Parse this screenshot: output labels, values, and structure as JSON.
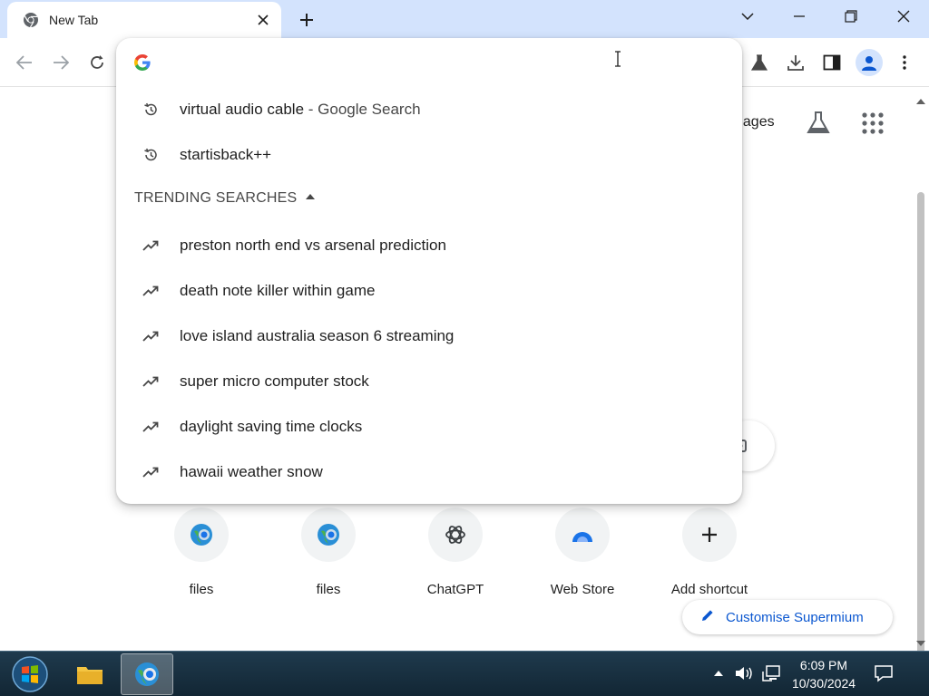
{
  "browser": {
    "tab": {
      "title": "New Tab",
      "favicon": "chrome-icon"
    },
    "toolbar": {
      "back": "back-arrow-icon",
      "forward": "forward-arrow-icon",
      "reload": "reload-icon",
      "labs": "labs-flask-icon",
      "download": "download-icon",
      "side_panel": "side-panel-icon",
      "profile": "profile-icon",
      "menu": "more-vert-icon"
    }
  },
  "omnibox": {
    "value": "",
    "recent": [
      {
        "text": "virtual audio cable",
        "suffix": " - Google Search",
        "icon": "history-icon"
      },
      {
        "text": "startisback++",
        "suffix": "",
        "icon": "history-icon"
      }
    ],
    "trending_header": "TRENDING SEARCHES",
    "trending": [
      {
        "text": "preston north end vs arsenal prediction"
      },
      {
        "text": "death note killer within game"
      },
      {
        "text": "love island australia season 6 streaming"
      },
      {
        "text": "super micro computer stock"
      },
      {
        "text": "daylight saving time clocks"
      },
      {
        "text": "hawaii weather snow"
      }
    ]
  },
  "page": {
    "images_link": "nages",
    "shortcuts": [
      {
        "label": "files",
        "icon": "globe-icon"
      },
      {
        "label": "files",
        "icon": "globe-icon"
      },
      {
        "label": "ChatGPT",
        "icon": "chatgpt-icon"
      },
      {
        "label": "Web Store",
        "icon": "web-store-icon"
      },
      {
        "label": "Add shortcut",
        "icon": "plus-icon"
      }
    ],
    "customise_label": "Customise Supermium"
  },
  "taskbar": {
    "time": "6:09 PM",
    "date": "10/30/2024"
  },
  "colors": {
    "titlebar": "#d3e3fd",
    "accent": "#0b57d0",
    "taskbar": "#1f3a4d"
  }
}
